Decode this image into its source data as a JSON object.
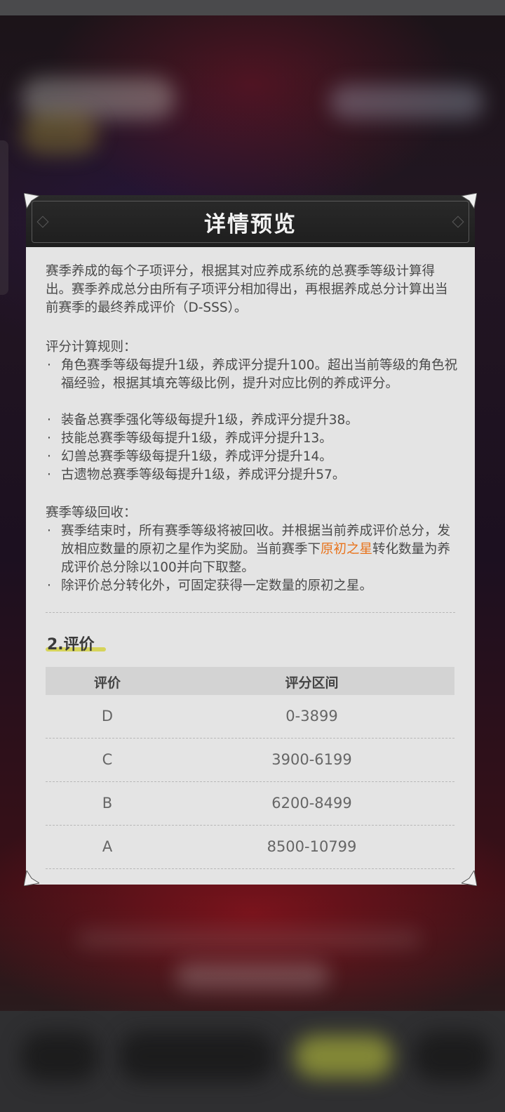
{
  "dialog": {
    "title": "详情预览",
    "intro": "赛季养成的每个子项评分，根据其对应养成系统的总赛季等级计算得出。赛季养成总分由所有子项评分相加得出，再根据养成总分计算出当前赛季的最终养成评价（D-SSS）。",
    "rules_heading": "评分计算规则：",
    "rules": [
      "角色赛季等级每提升1级，养成评分提升100。超出当前等级的角色祝福经验，根据其填充等级比例，提升对应比例的养成评分。",
      "装备总赛季强化等级每提升1级，养成评分提升38。",
      "技能总赛季等级每提升1级，养成评分提升13。",
      "幻兽总赛季等级每提升1级，养成评分提升14。",
      "古遗物总赛季等级每提升1级，养成评分提升57。"
    ],
    "recycle_heading": "赛季等级回收：",
    "recycle": {
      "item1_before": "赛季结束时，所有赛季等级将被回收。并根据当前养成评价总分，发放相应数量的原初之星作为奖励。当前赛季下",
      "item1_highlight": "原初之星",
      "item1_after": "转化数量为养成评价总分除以100并向下取整。",
      "item2": "除评价总分转化外，可固定获得一定数量的原初之星。"
    },
    "bullet": "·",
    "section2_title": "2.评价",
    "table": {
      "headers": [
        "评价",
        "评分区间"
      ],
      "rows": [
        {
          "grade": "D",
          "range": "0-3899"
        },
        {
          "grade": "C",
          "range": "3900-6199"
        },
        {
          "grade": "B",
          "range": "6200-8499"
        },
        {
          "grade": "A",
          "range": "8500-10799"
        }
      ]
    },
    "colors": {
      "highlight": "#e8731c",
      "accent_underline": "#d4d24a",
      "panel_bg": "#e4e4e4",
      "header_bg": "#222222"
    }
  }
}
